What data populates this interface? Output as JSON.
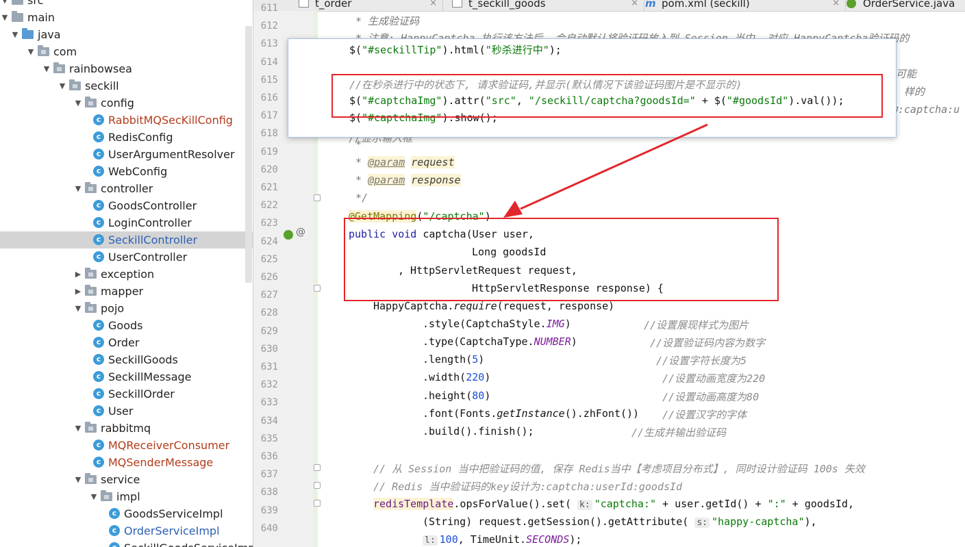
{
  "tree": {
    "items": [
      {
        "label": "src",
        "level": 0,
        "kind": "folder",
        "expanded": true
      },
      {
        "label": "main",
        "level": 0,
        "kind": "folder",
        "expanded": true
      },
      {
        "label": "java",
        "level": 1,
        "kind": "folder-blue",
        "expanded": true
      },
      {
        "label": "com",
        "level": 2,
        "kind": "package",
        "expanded": true
      },
      {
        "label": "rainbowsea",
        "level": 3,
        "kind": "package",
        "expanded": true
      },
      {
        "label": "seckill",
        "level": 4,
        "kind": "package",
        "expanded": true
      },
      {
        "label": "config",
        "level": 5,
        "kind": "package",
        "expanded": true
      },
      {
        "label": "RabbitMQSecKillConfig",
        "level": 6,
        "kind": "class",
        "status": "error"
      },
      {
        "label": "RedisConfig",
        "level": 6,
        "kind": "class"
      },
      {
        "label": "UserArgumentResolver",
        "level": 6,
        "kind": "class"
      },
      {
        "label": "WebConfig",
        "level": 6,
        "kind": "class"
      },
      {
        "label": "controller",
        "level": 5,
        "kind": "package",
        "expanded": true
      },
      {
        "label": "GoodsController",
        "level": 6,
        "kind": "class"
      },
      {
        "label": "LoginController",
        "level": 6,
        "kind": "class"
      },
      {
        "label": "SeckillController",
        "level": 6,
        "kind": "class",
        "status": "selected"
      },
      {
        "label": "UserController",
        "level": 6,
        "kind": "class"
      },
      {
        "label": "exception",
        "level": 5,
        "kind": "package",
        "expanded": false
      },
      {
        "label": "mapper",
        "level": 5,
        "kind": "package",
        "expanded": false
      },
      {
        "label": "pojo",
        "level": 5,
        "kind": "package",
        "expanded": true
      },
      {
        "label": "Goods",
        "level": 6,
        "kind": "class"
      },
      {
        "label": "Order",
        "level": 6,
        "kind": "class"
      },
      {
        "label": "SeckillGoods",
        "level": 6,
        "kind": "class"
      },
      {
        "label": "SeckillMessage",
        "level": 6,
        "kind": "class"
      },
      {
        "label": "SeckillOrder",
        "level": 6,
        "kind": "class"
      },
      {
        "label": "User",
        "level": 6,
        "kind": "class"
      },
      {
        "label": "rabbitmq",
        "level": 5,
        "kind": "package",
        "expanded": true
      },
      {
        "label": "MQReceiverConsumer",
        "level": 6,
        "kind": "class",
        "status": "error"
      },
      {
        "label": "MQSenderMessage",
        "level": 6,
        "kind": "class",
        "status": "error"
      },
      {
        "label": "service",
        "level": 5,
        "kind": "package",
        "expanded": true
      },
      {
        "label": "impl",
        "level": 6,
        "kind": "package",
        "expanded": true
      },
      {
        "label": "GoodsServiceImpl",
        "level": 7,
        "kind": "class"
      },
      {
        "label": "OrderServiceImpl",
        "level": 7,
        "kind": "class",
        "status": "modified"
      },
      {
        "label": "SeckillGoodsServiceImpl",
        "level": 7,
        "kind": "class"
      }
    ]
  },
  "tabs": [
    {
      "label": "t_order",
      "icon": "table-icon"
    },
    {
      "label": "t_seckill_goods",
      "icon": "table-icon"
    },
    {
      "label": "pom.xml (seckill)",
      "icon": "maven-icon"
    },
    {
      "label": "OrderService.java",
      "icon": "interface-icon"
    }
  ],
  "line_numbers": [
    "611",
    "612",
    "613",
    "614",
    "615",
    "616",
    "617",
    "618",
    "619",
    "620",
    "621",
    "622",
    "623",
    "624",
    "625",
    "626",
    "627",
    "628",
    "629",
    "630",
    "631",
    "632",
    "633",
    "634",
    "635",
    "636",
    "637",
    "638",
    "639",
    "640"
  ],
  "code": {
    "l611": "* 生成验证码",
    "l612": "* 注意: HappyCaptcha 执行该方法后, 会自动默认将验证码放入到 Session 当中, 对应 HappyCaptcha验证码的",
    "l614_tail": "可能",
    "l615_tail": "样的",
    "l616_tail": "为:captcha:u",
    "l617": "//显示输入框",
    "l618": "*",
    "l619_star": "* ",
    "l619_tag": "@param",
    "l619_par": "request",
    "l620_star": "* ",
    "l620_tag": "@param",
    "l620_par": "response",
    "l621": "*/",
    "l622_ann": "@GetMapping",
    "l622_str": "\"/captcha\"",
    "l623_kw1": "public",
    "l623_kw2": "void",
    "l623_rest": " captcha(User user,",
    "l624": "Long goodsId",
    "l625": ", HttpServletRequest request,",
    "l626": "HttpServletResponse response) {",
    "l627_a": "HappyCaptcha.",
    "l627_b": "require",
    "l627_c": "(request, response)",
    "l628_a": ".style(CaptchaStyle.",
    "l628_b": "IMG",
    "l628_c": ")",
    "l628_cmt": "//设置展现样式为图片",
    "l629_a": ".type(CaptchaType.",
    "l629_b": "NUMBER",
    "l629_c": ")",
    "l629_cmt": "//设置验证码内容为数字",
    "l630_a": ".length(",
    "l630_b": "5",
    "l630_c": ")",
    "l630_cmt": "//设置字符长度为5",
    "l631_a": ".width(",
    "l631_b": "220",
    "l631_c": ")",
    "l631_cmt": "//设置动画宽度为220",
    "l632_a": ".height(",
    "l632_b": "80",
    "l632_c": ")",
    "l632_cmt": "//设置动画高度为80",
    "l633_a": ".font(Fonts.",
    "l633_b": "getInstance",
    "l633_c": "().zhFont())",
    "l633_cmt": "//设置汉字的字体",
    "l634_a": ".build().finish();",
    "l634_cmt": "//生成并输出验证码",
    "l636": "// 从 Session 当中把验证码的值, 保存 Redis当中【考虑项目分布式】, 同时设计验证码 100s 失效",
    "l637": "// Redis 当中验证码的key设计为:captcha:userId:goodsId",
    "l638_a": "redisTemplate",
    "l638_b": ".opsForValue().set(",
    "l638_hint": "k:",
    "l638_str1": "\"captcha:\"",
    "l638_c": " + user.getId() + ",
    "l638_str2": "\":\"",
    "l638_d": " + goodsId,",
    "l639_a": "(String) request.getSession().getAttribute(",
    "l639_hint": "s:",
    "l639_str": "\"happy-captcha\"",
    "l639_b": "),",
    "l640_hint": "l:",
    "l640_num": "100",
    "l640_a": ", TimeUnit.",
    "l640_b": "SECONDS",
    "l640_c": ");"
  },
  "popup": {
    "p1_a": "$(",
    "p1_str": "\"#seckillTip\"",
    "p1_b": ").html(",
    "p1_str2": "\"秒杀进行中\"",
    "p1_c": ");",
    "p2": "//在秒杀进行中的状态下, 请求验证码,并显示(默认情况下该验证码图片是不显示的)",
    "p3_a": "$(",
    "p3_str": "\"#captchaImg\"",
    "p3_b": ").attr(",
    "p3_str2": "\"src\"",
    "p3_c": ", ",
    "p3_str3": "\"/seckill/captcha?goodsId=\"",
    "p3_d": " + $(",
    "p3_str4": "\"#goodsId\"",
    "p3_e": ").val());",
    "p4_a": "$(",
    "p4_str": "\"#captchaImg\"",
    "p4_b": ").show();"
  },
  "colors": {
    "annotation": "#e3262b",
    "selection": "#d4d4d4",
    "error_text": "#b33c1b",
    "selected_text": "#2b5fb4"
  }
}
